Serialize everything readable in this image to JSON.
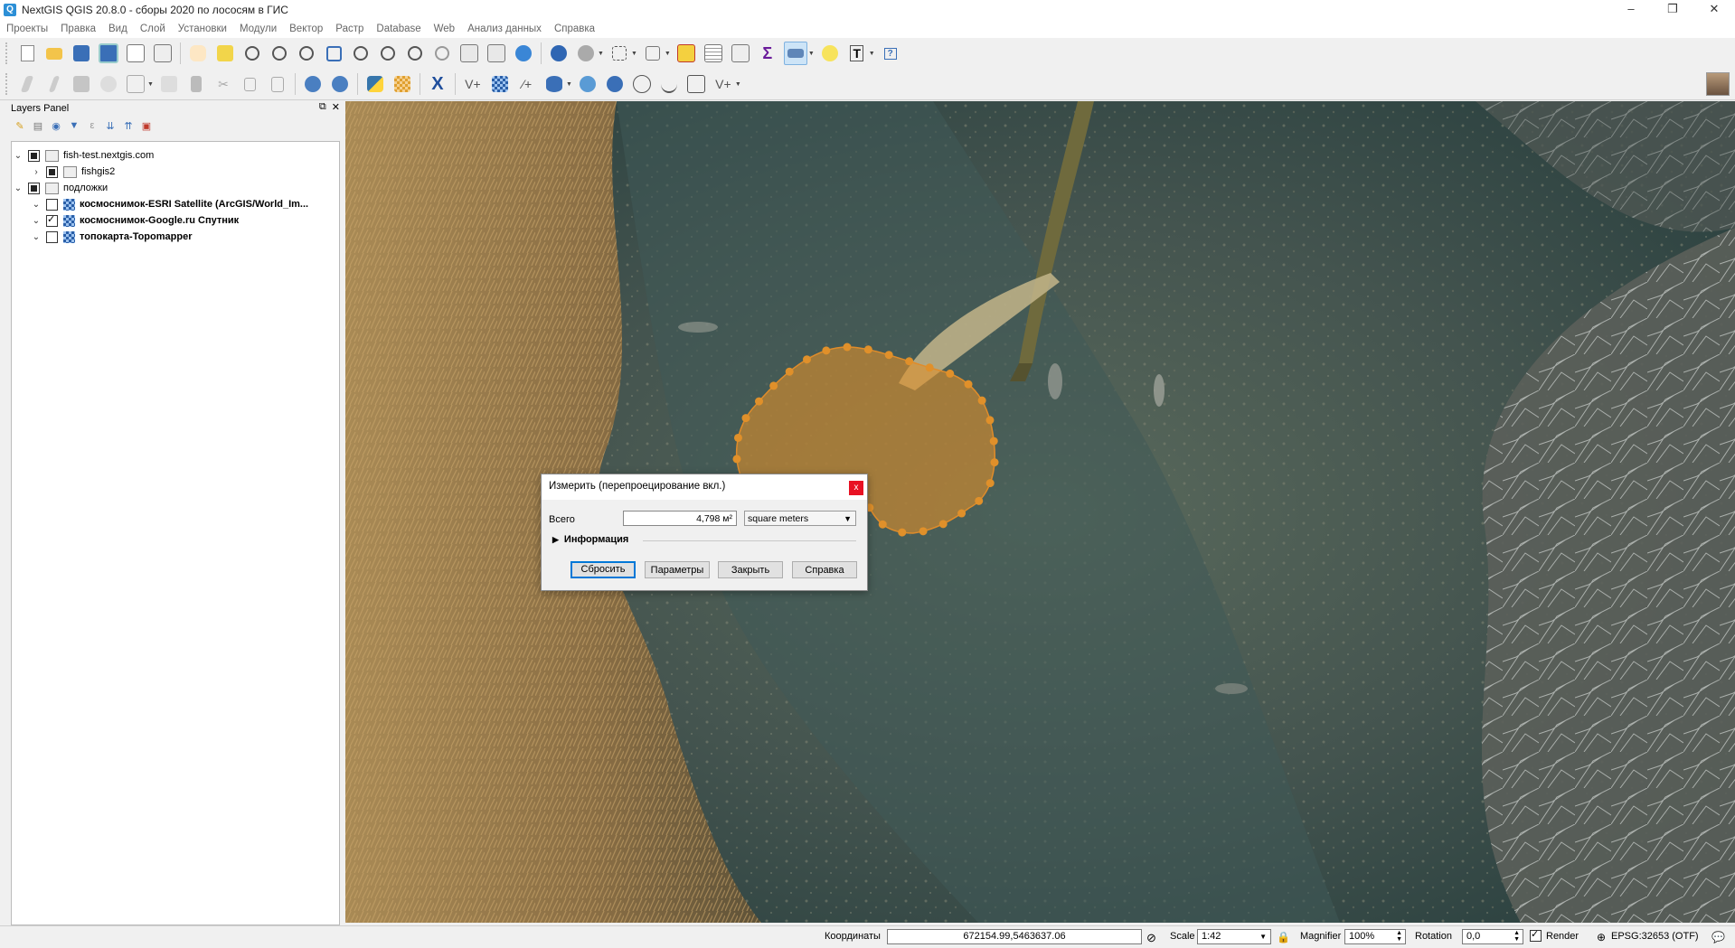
{
  "window": {
    "title": "NextGIS QGIS 20.8.0 - сборы 2020 по лососям в ГИС",
    "minimize": "–",
    "restore": "❐",
    "close": "✕"
  },
  "menu": [
    "Проекты",
    "Правка",
    "Вид",
    "Слой",
    "Установки",
    "Модули",
    "Вектор",
    "Растр",
    "Database",
    "Web",
    "Анализ данных",
    "Справка"
  ],
  "layers_panel": {
    "title": "Layers Panel",
    "float_icon": "⧉",
    "close_icon": "✕",
    "tree": [
      {
        "label": "fish-test.nextgis.com",
        "expanded": true,
        "level": 0
      },
      {
        "label": "fishgis2",
        "expanded": false,
        "level": 1
      },
      {
        "label": "подложки",
        "expanded": true,
        "level": 0
      },
      {
        "label": "космоснимок-ESRI Satellite (ArcGIS/World_Im...",
        "level": 1,
        "checked": false
      },
      {
        "label": "космоснимок-Google.ru Спутник",
        "level": 1,
        "checked": true
      },
      {
        "label": "топокарта-Topomapper",
        "level": 1,
        "checked": false
      }
    ]
  },
  "measure_dialog": {
    "title": "Измерить (перепроецирование вкл.)",
    "close": "x",
    "total_label": "Всего",
    "total_value": "4,798 м²",
    "unit": "square meters",
    "info_label": "Информация",
    "buttons": {
      "reset": "Сбросить",
      "params": "Параметры",
      "close": "Закрыть",
      "help": "Справка"
    }
  },
  "statusbar": {
    "coord_label": "Координаты",
    "coord_value": "672154.99,5463637.06",
    "scale_label": "Scale",
    "scale_value": "1:42",
    "magnifier_label": "Magnifier",
    "magnifier_value": "100%",
    "rotation_label": "Rotation",
    "rotation_value": "0,0",
    "render_label": "Render",
    "render_checked": true,
    "crs": "EPSG:32653 (OTF)"
  },
  "colors": {
    "accent": "#0078d7",
    "measure_fill": "#e0902a",
    "close_red": "#e81123"
  }
}
